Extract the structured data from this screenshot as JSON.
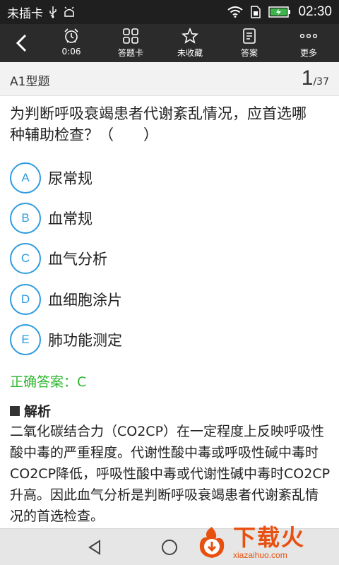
{
  "status_bar": {
    "carrier": "未插卡",
    "time": "02:30",
    "icons": [
      "usb-icon",
      "android-debug-icon",
      "wifi-icon",
      "sim-icon",
      "battery-charging-icon"
    ],
    "battery_color": "#3cb64a"
  },
  "toolbar": {
    "back_icon": "back-chevron-icon",
    "items": [
      {
        "label": "0:06",
        "icon": "alarm-clock-icon"
      },
      {
        "label": "答题卡",
        "icon": "grid-icon"
      },
      {
        "label": "未收藏",
        "icon": "star-outline-icon"
      },
      {
        "label": "答案",
        "icon": "document-icon"
      },
      {
        "label": "更多",
        "icon": "more-dots-icon"
      }
    ]
  },
  "question_header": {
    "type": "A1型题",
    "current": "1",
    "total": "/37"
  },
  "question": {
    "text": "为判断呼吸衰竭患者代谢紊乱情况，应首选哪种辅助检查？（　　）"
  },
  "options": [
    {
      "letter": "A",
      "text": "尿常规"
    },
    {
      "letter": "B",
      "text": "血常规"
    },
    {
      "letter": "C",
      "text": "血气分析"
    },
    {
      "letter": "D",
      "text": "血细胞涂片"
    },
    {
      "letter": "E",
      "text": "肺功能测定"
    }
  ],
  "answer": {
    "text": "正确答案：C",
    "color": "#2cb52c"
  },
  "analysis": {
    "title": "解析",
    "text": "二氧化碳结合力（CO2CP）在一定程度上反映呼吸性酸中毒的严重程度。代谢性酸中毒或呼吸性碱中毒时CO2CP降低，呼吸性酸中毒或代谢性碱中毒时CO2CP升高。因此血气分析是判断呼吸衰竭患者代谢紊乱情况的首选检查。"
  },
  "nav_bar": {
    "icons": [
      "nav-back-icon",
      "nav-home-icon"
    ]
  },
  "watermark": {
    "text": "下载火",
    "sub": "xiazaihuo.com",
    "color": "#e8500f"
  },
  "accent_color": "#2e9be0"
}
